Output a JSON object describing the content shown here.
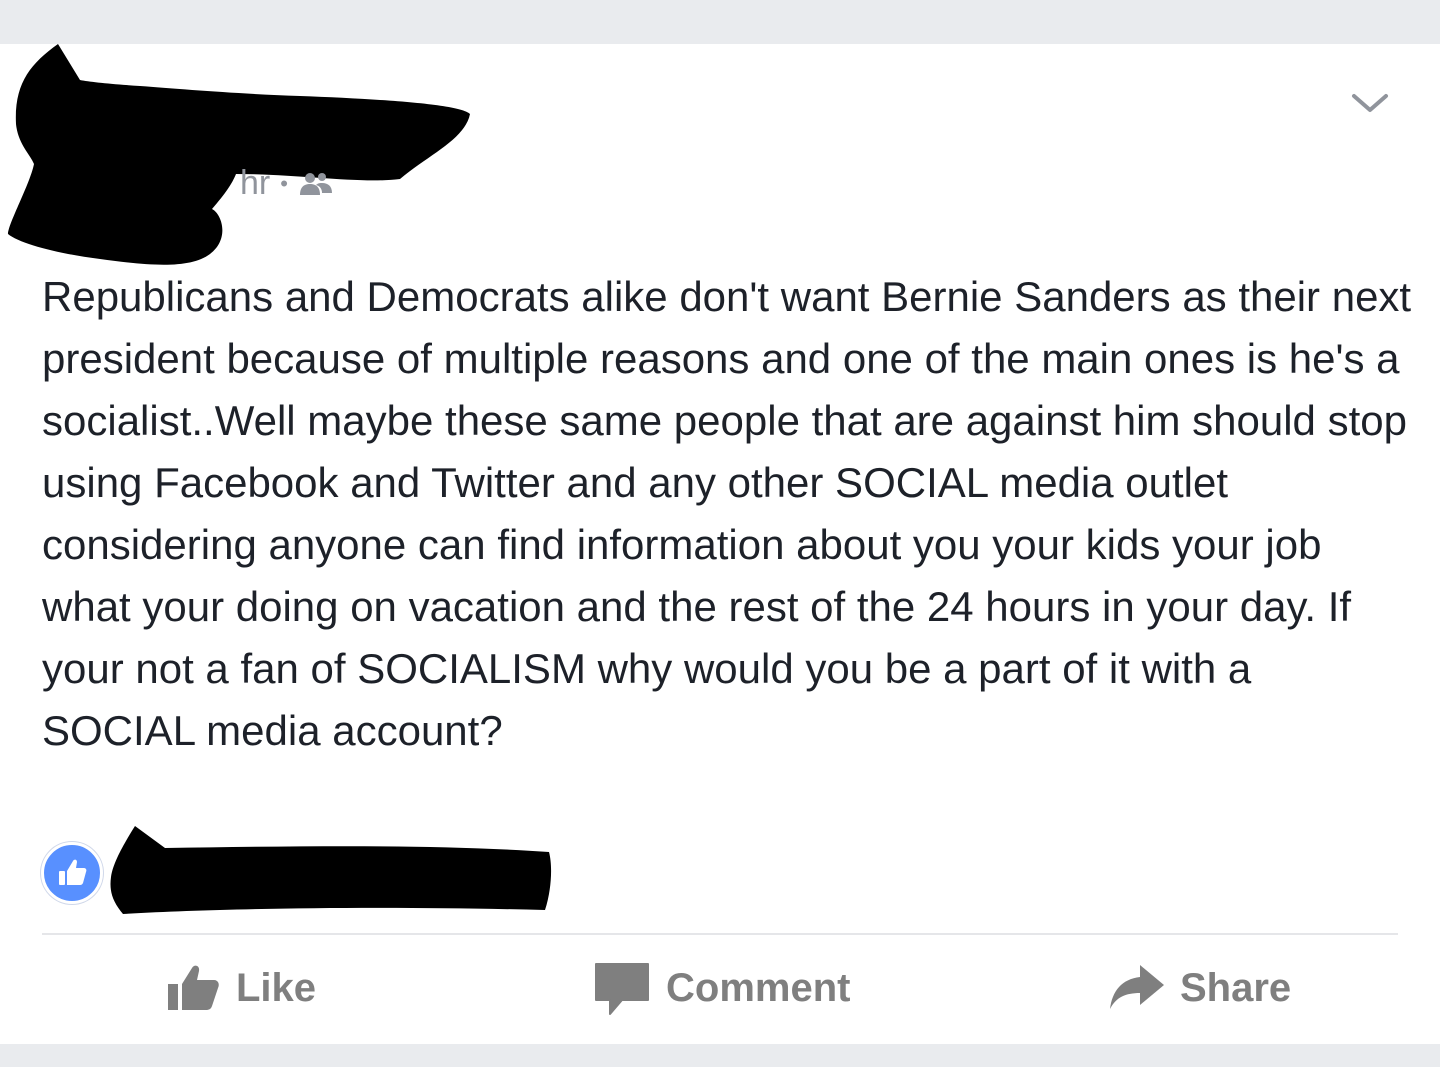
{
  "post": {
    "timestamp": "hr",
    "separator": "•",
    "audience_icon": "friends-icon",
    "menu_icon": "chevron-down-icon",
    "text": "Republicans and Democrats alike don't want Bernie Sanders as their next president because of multiple reasons and one of the main ones is he's a socialist..Well maybe these same people that are against him should stop using Facebook and Twitter and any other SOCIAL media outlet considering anyone can find information about you your kids your job what your doing on vacation and the rest of the 24 hours in your day. If your not a fan of SOCIALISM why would you be a part of it with a SOCIAL media account?"
  },
  "reactions": {
    "icon": "thumbs-up-icon",
    "color": "#5890ff"
  },
  "actions": {
    "like_label": "Like",
    "comment_label": "Comment",
    "share_label": "Share"
  },
  "colors": {
    "text": "#1d2129",
    "meta": "#90949c",
    "action": "#7f7f7f",
    "background": "#e9ebee",
    "redaction": "#000000"
  }
}
